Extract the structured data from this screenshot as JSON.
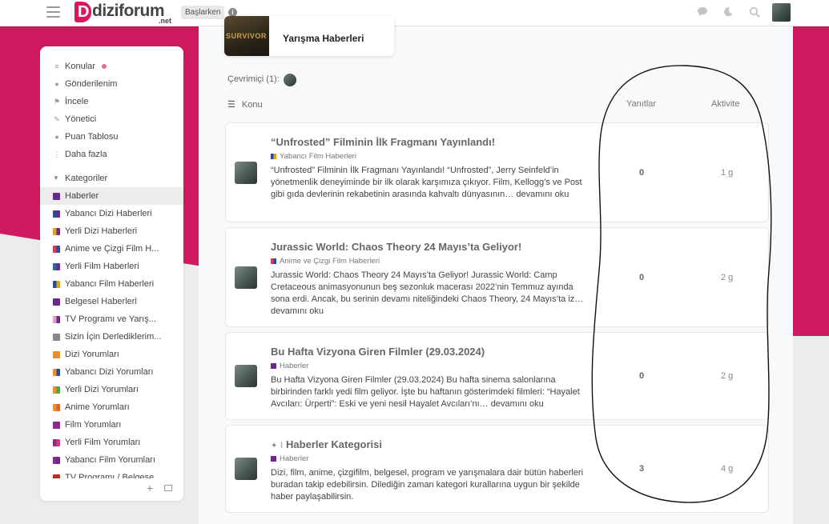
{
  "colors": {
    "brand": "#cf1a5f",
    "logo": "#d8185e"
  },
  "header": {
    "logo_main": "diziforum",
    "logo_sub": ".net",
    "breadcrumb": "Başlarken",
    "icons": [
      "hamburger-icon",
      "chat-icon",
      "moon-icon",
      "search-icon"
    ]
  },
  "sidebar": {
    "nav": [
      {
        "label": "Konular",
        "icon": "layers-icon"
      },
      {
        "label": "Gönderilenim",
        "icon": "user-icon"
      },
      {
        "label": "İncele",
        "icon": "flag-icon"
      },
      {
        "label": "Yönetici",
        "icon": "wrench-icon"
      },
      {
        "label": "Puan Tablosu",
        "icon": "circle-icon"
      },
      {
        "label": "Daha fazla",
        "icon": "more-icon"
      }
    ],
    "categories_label": "Kategoriler",
    "categories": [
      {
        "label": "Haberler",
        "colors": [
          "#6a2a8a",
          "#6a2a8a"
        ]
      },
      {
        "label": "Yabancı Dizi Haberleri",
        "colors": [
          "#2a4a9a",
          "#6a2a8a"
        ]
      },
      {
        "label": "Yerli Dizi Haberleri",
        "colors": [
          "#e0a020",
          "#6a2a8a"
        ]
      },
      {
        "label": "Anime ve Çizgi Film H...",
        "colors": [
          "#d83a5a",
          "#2a4a9a"
        ]
      },
      {
        "label": "Yerli Film Haberleri",
        "colors": [
          "#2a6a9a",
          "#6a2a8a"
        ]
      },
      {
        "label": "Yabancı Film Haberleri",
        "colors": [
          "#2a4a9a",
          "#e0a020"
        ]
      },
      {
        "label": "Belgesel Haberleri",
        "colors": [
          "#6a2a8a",
          "#6a2a8a"
        ]
      },
      {
        "label": "TV Programı ve Yarış...",
        "colors": [
          "#d8a0c0",
          "#6a2a8a"
        ]
      },
      {
        "label": "Sizin İçin Derlediklerim...",
        "colors": [
          "#888888",
          "#888888"
        ]
      },
      {
        "label": "Dizi Yorumları",
        "colors": [
          "#e89030",
          "#e89030"
        ]
      },
      {
        "label": "Yabancı Dizi Yorumları",
        "colors": [
          "#e89030",
          "#2a4a9a"
        ]
      },
      {
        "label": "Yerli Dizi Yorumları",
        "colors": [
          "#e89030",
          "#4aaa4a"
        ]
      },
      {
        "label": "Anime Yorumları",
        "colors": [
          "#e89030",
          "#e06030"
        ]
      },
      {
        "label": "Film Yorumları",
        "colors": [
          "#8a2a8a",
          "#8a2a8a"
        ]
      },
      {
        "label": "Yerli Film Yorumları",
        "colors": [
          "#8a2a8a",
          "#d83a7a"
        ]
      },
      {
        "label": "Yabancı Film Yorumları",
        "colors": [
          "#8a2a8a",
          "#6a2a8a"
        ]
      },
      {
        "label": "TV Programı / Belgese...",
        "colors": [
          "#c02a2a",
          "#c02a2a"
        ]
      }
    ],
    "footer_plus": "+"
  },
  "category_card": {
    "title": "Yarışma Haberleri",
    "image_text": "SURVIVOR"
  },
  "online": {
    "label": "Çevrimiçi (1):"
  },
  "columns": {
    "topic": "Konu",
    "replies": "Yanıtlar",
    "activity": "Aktivite"
  },
  "topics": [
    {
      "title": "“Unfrosted” Filminin İlk Fragmanı Yayınlandı!",
      "category": "Yabancı Film Haberleri",
      "cat_colors": [
        "#2a4a9a",
        "#e0a020"
      ],
      "excerpt": "“Unfrosted” Filminin İlk Fragmanı Yayınlandı! “Unfrosted”, Jerry Seinfeld’in yönetmenlik deneyiminde bir ilk olarak karşımıza çıkıyor. Film, Kellogg’s ve Post gibi gıda devlerinin rekabetinin arasında kahvaltı dünyasının… devamını oku",
      "replies": "0",
      "activity": "1 g"
    },
    {
      "title": "Jurassic World: Chaos Theory 24 Mayıs’ta Geliyor!",
      "category": "Anime ve Çizgi Film Haberleri",
      "cat_colors": [
        "#d83a5a",
        "#2a4a9a"
      ],
      "excerpt": "Jurassic World: Chaos Theory 24 Mayıs’ta Geliyor! Jurassic World: Camp Cretaceous animasyonunun beş sezonluk macerası 2022’nin Temmuz ayında sona erdi. Ancak, bu serinin devamı niteliğindeki Chaos Theory, 24 Mayıs’ta iz… devamını oku",
      "replies": "0",
      "activity": "2 g"
    },
    {
      "title": "Bu Hafta Vizyona Giren Filmler (29.03.2024)",
      "category": "Haberler",
      "cat_colors": [
        "#6a2a8a",
        "#6a2a8a"
      ],
      "excerpt": "Bu Hafta Vizyona Giren Filmler (29.03.2024) Bu hafta sinema salonlarına birbirinden farklı yedi film geliyor. İşte bu haftanın gösterimdeki filmleri: “Hayalet Avcıları: Ürperti”: Eski ve yeni nesil Hayalet Avcıları’nı… devamını oku",
      "replies": "0",
      "activity": "2 g"
    },
    {
      "title": "Haberler Kategorisi",
      "title_prefix": "✦ ⌇",
      "category": "Haberler",
      "cat_colors": [
        "#6a2a8a",
        "#6a2a8a"
      ],
      "excerpt": "Dizi, film, anime, çizgifilm, belgesel, program ve yarışmalara dair bütün haberleri buradan takip edebilirsin. Dilediğin zaman kategori kurallarına uygun bir şekilde haber paylaşabilirsin.",
      "replies": "3",
      "activity": "4 g"
    }
  ]
}
